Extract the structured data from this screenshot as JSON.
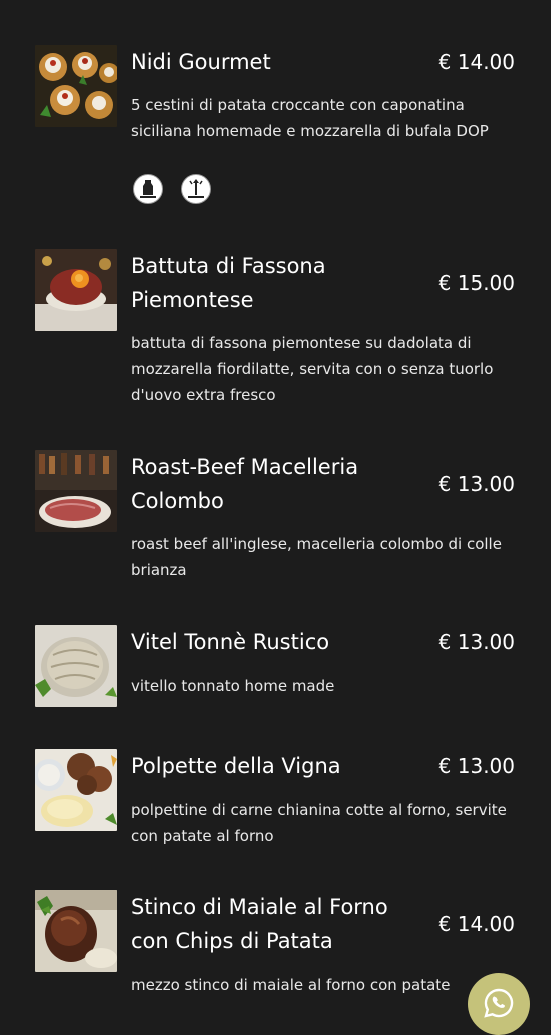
{
  "menu": {
    "items": [
      {
        "title": "Nidi Gourmet",
        "price": "€ 14.00",
        "description": "5 cestini di patata croccante con caponatina siciliana homemade e mozzarella di bufala DOP",
        "allergens": [
          {
            "icon": "lactose-icon",
            "label": "LACTOSE"
          },
          {
            "icon": "celery-icon",
            "label": "CELERY"
          }
        ]
      },
      {
        "title": "Battuta di Fassona Piemontese",
        "price": "€ 15.00",
        "description": "battuta di fassona piemontese su dadolata di mozzarella fiordilatte, servita con o senza tuorlo d'uovo extra fresco"
      },
      {
        "title": "Roast-Beef Macelleria Colombo",
        "price": "€ 13.00",
        "description": "roast beef all'inglese, macelleria colombo di colle brianza"
      },
      {
        "title": "Vitel Tonnè Rustico",
        "price": "€ 13.00",
        "description": "vitello tonnato home made"
      },
      {
        "title": "Polpette della Vigna",
        "price": "€ 13.00",
        "description": "polpettine di carne chianina cotte al forno, servite con patate al forno"
      },
      {
        "title": "Stinco di Maiale al Forno con Chips di Patata",
        "price": "€ 14.00",
        "description": "mezzo stinco di maiale al forno con patate"
      }
    ]
  },
  "floating_button": {
    "icon": "whatsapp-icon",
    "color": "#c5c27a"
  },
  "colors": {
    "background": "#1c1c1c",
    "text": "#ffffff"
  }
}
